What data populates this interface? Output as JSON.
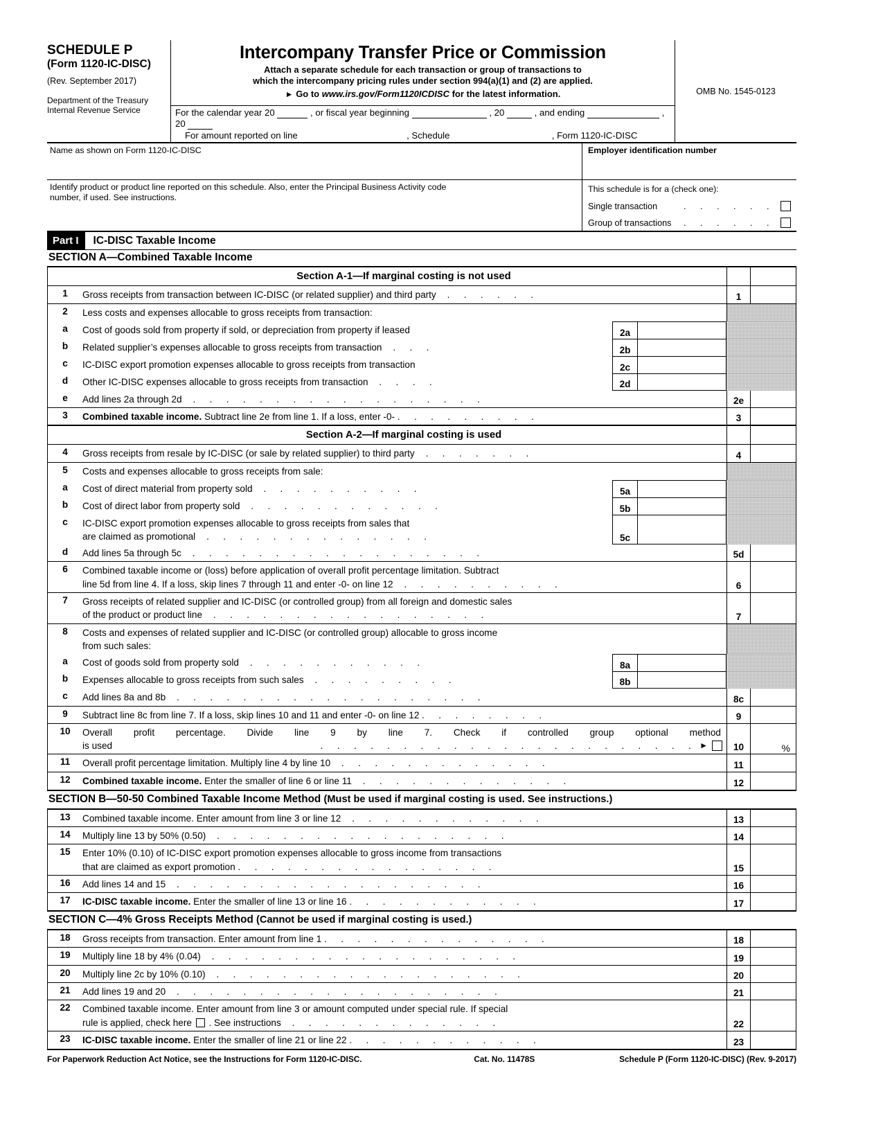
{
  "header": {
    "schedule_name": "SCHEDULE P",
    "form_ref": "(Form 1120-IC-DISC)",
    "revision": "(Rev. September 2017)",
    "dept_line1": "Department of the Treasury",
    "dept_line2": "Internal Revenue Service",
    "title": "Intercompany Transfer Price or Commission",
    "subtitle_line1": "Attach a separate schedule for each transaction or group of transactions to",
    "subtitle_line2": "which the intercompany pricing rules under section 994(a)(1) and (2) are applied.",
    "goto_prefix": "Go to",
    "goto_url": "www.irs.gov/Form1120ICDISC",
    "goto_suffix": "for the latest information.",
    "omb": "OMB No. 1545-0123",
    "year_line_a": "For the calendar year 20",
    "year_line_b": ", or fiscal year beginning",
    "year_line_c": ", 20",
    "year_line_d": ", and ending",
    "year_line_e": ", 20",
    "amount_line_a": "For amount reported on line",
    "amount_line_b": ", Schedule",
    "amount_line_c": ", Form 1120-IC-DISC"
  },
  "entity": {
    "name_label": "Name as shown on Form 1120-IC-DISC",
    "name_value": "",
    "ein_label": "Employer identification number",
    "ein_value": "",
    "product_label_line1": "Identify product or product line reported on this schedule. Also, enter the Principal Business Activity code",
    "product_label_line2": "number, if used. See instructions.",
    "product_value": "",
    "check_one_label": "This schedule is for a (check one):",
    "single_transaction": "Single transaction",
    "group_of_transactions": "Group of transactions"
  },
  "part1": {
    "tag": "Part I",
    "title": "IC-DISC Taxable Income",
    "section_a": "SECTION A—Combined Taxable Income",
    "section_a1": "Section A-1—If marginal costing is not used",
    "section_a2": "Section A-2—If marginal costing is used",
    "section_b_bold": "SECTION B—50-50 Combined Taxable Income Method",
    "section_b_rest": "(Must be used if marginal costing is used. See instructions.)",
    "section_c_bold": "SECTION C—4% Gross Receipts Method",
    "section_c_rest": "(Cannot be used if marginal costing is used.)"
  },
  "lines": {
    "l1": {
      "no": "1",
      "text": "Gross receipts from transaction between IC-DISC (or related supplier) and third party",
      "box": "1",
      "value": ""
    },
    "l2": {
      "no": "2",
      "text": "Less costs and expenses allocable to gross receipts from transaction:"
    },
    "l2a": {
      "no": "a",
      "text": "Cost of goods sold from property if sold, or depreciation from property if leased",
      "box": "2a",
      "value": ""
    },
    "l2b": {
      "no": "b",
      "text": "Related supplier’s expenses allocable to gross receipts from transaction",
      "box": "2b",
      "value": ""
    },
    "l2c": {
      "no": "c",
      "text": "IC-DISC export promotion expenses allocable to gross receipts from transaction",
      "box": "2c",
      "value": ""
    },
    "l2d": {
      "no": "d",
      "text": "Other IC-DISC expenses allocable to gross receipts from transaction",
      "box": "2d",
      "value": ""
    },
    "l2e": {
      "no": "e",
      "text": "Add lines 2a through 2d",
      "box": "2e",
      "value": ""
    },
    "l3": {
      "no": "3",
      "bold": "Combined taxable income.",
      "text": "Subtract line 2e from line 1. If a loss, enter -0-",
      "box": "3",
      "value": ""
    },
    "l4": {
      "no": "4",
      "text": "Gross receipts from resale by IC-DISC (or sale by related supplier) to third party",
      "box": "4",
      "value": ""
    },
    "l5": {
      "no": "5",
      "text": "Costs and expenses allocable to gross receipts from sale:"
    },
    "l5a": {
      "no": "a",
      "text": "Cost of direct material from property sold",
      "box": "5a",
      "value": ""
    },
    "l5b": {
      "no": "b",
      "text": "Cost of direct labor from property sold",
      "box": "5b",
      "value": ""
    },
    "l5c": {
      "no": "c",
      "text": "IC-DISC export promotion expenses allocable to gross receipts from sales that",
      "text2": "are claimed as promotional",
      "box": "5c",
      "value": ""
    },
    "l5d": {
      "no": "d",
      "text": "Add lines 5a through 5c",
      "box": "5d",
      "value": ""
    },
    "l6": {
      "no": "6",
      "text": "Combined taxable income or (loss) before application of overall profit percentage limitation. Subtract",
      "text2": "line 5d from line 4. If a loss, skip lines 7 through 11 and enter -0- on line 12",
      "box": "6",
      "value": ""
    },
    "l7": {
      "no": "7",
      "text": "Gross receipts of related supplier and IC-DISC (or controlled group) from all foreign and domestic sales",
      "text2": "of the product or product line",
      "box": "7",
      "value": ""
    },
    "l8": {
      "no": "8",
      "text": "Costs and expenses of related supplier and IC-DISC (or controlled group) allocable to gross income",
      "text2": "from such sales:"
    },
    "l8a": {
      "no": "a",
      "text": "Cost of goods sold from property sold",
      "box": "8a",
      "value": ""
    },
    "l8b": {
      "no": "b",
      "text": "Expenses allocable to gross receipts from such sales",
      "box": "8b",
      "value": ""
    },
    "l8c": {
      "no": "c",
      "text": "Add lines 8a and 8b",
      "box": "8c",
      "value": ""
    },
    "l9": {
      "no": "9",
      "text": "Subtract line 8c from line 7. If a loss, skip lines 10 and 11 and enter -0- on line 12",
      "box": "9",
      "value": ""
    },
    "l10": {
      "no": "10",
      "text": "Overall profit percentage. Divide line 9 by line 7. Check if controlled group optional method",
      "text2": "is used",
      "box": "10",
      "value": "",
      "suffix": "%"
    },
    "l11": {
      "no": "11",
      "text": "Overall profit percentage limitation. Multiply line 4 by line 10",
      "box": "11",
      "value": ""
    },
    "l12": {
      "no": "12",
      "bold": "Combined taxable income.",
      "text": "Enter the smaller of line 6 or line 11",
      "box": "12",
      "value": ""
    },
    "l13": {
      "no": "13",
      "text": "Combined taxable income. Enter amount from line 3 or line 12",
      "box": "13",
      "value": ""
    },
    "l14": {
      "no": "14",
      "text": "Multiply line 13 by 50% (0.50)",
      "box": "14",
      "value": ""
    },
    "l15": {
      "no": "15",
      "text": "Enter 10% (0.10) of IC-DISC export promotion expenses allocable to gross income from transactions",
      "text2": "that are claimed as export promotion",
      "box": "15",
      "value": ""
    },
    "l16": {
      "no": "16",
      "text": "Add lines 14 and 15",
      "box": "16",
      "value": ""
    },
    "l17": {
      "no": "17",
      "bold": "IC-DISC",
      "bold2": "taxable income.",
      "text": "Enter the smaller of line 13 or line 16",
      "box": "17",
      "value": ""
    },
    "l18": {
      "no": "18",
      "text": "Gross receipts from transaction. Enter amount from line 1",
      "box": "18",
      "value": ""
    },
    "l19": {
      "no": "19",
      "text": "Multiply line 18 by 4% (0.04)",
      "box": "19",
      "value": ""
    },
    "l20": {
      "no": "20",
      "text": "Multiply line 2c by 10% (0.10)",
      "box": "20",
      "value": ""
    },
    "l21": {
      "no": "21",
      "text": "Add lines 19 and 20",
      "box": "21",
      "value": ""
    },
    "l22": {
      "no": "22",
      "text": "Combined taxable income. Enter amount from line 3 or amount computed under special rule. If special",
      "text2a": "rule is applied, check here",
      "text2b": ". See instructions",
      "box": "22",
      "value": ""
    },
    "l23": {
      "no": "23",
      "bold": "IC-DISC taxable income.",
      "text": "Enter the smaller of line 21 or line 22",
      "box": "23",
      "value": ""
    }
  },
  "footer": {
    "left": "For Paperwork Reduction Act Notice, see the Instructions for Form 1120-IC-DISC.",
    "center": "Cat. No. 11478S",
    "right": "Schedule P (Form 1120-IC-DISC) (Rev. 9-2017)"
  }
}
